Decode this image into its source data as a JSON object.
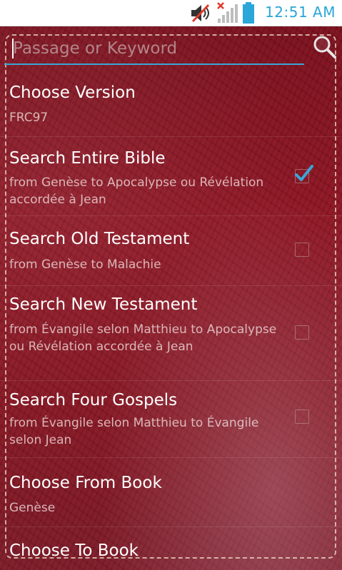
{
  "status_bar": {
    "time": "12:51 AM",
    "icons": [
      "speaker-muted-icon",
      "signal-off-icon",
      "battery-icon"
    ]
  },
  "search": {
    "placeholder": "Passage or Keyword",
    "value": "",
    "icon": "search-icon"
  },
  "options": [
    {
      "title": "Choose Version",
      "subtitle": "FRC97"
    },
    {
      "title": "Search Entire Bible",
      "subtitle": "from Genèse to Apocalypse ou Révélation accordée à Jean",
      "checked": true
    },
    {
      "title": "Search Old Testament",
      "subtitle": "from Genèse to Malachie",
      "checked": false
    },
    {
      "title": "Search New Testament",
      "subtitle": "from Évangile selon Matthieu to Apocalypse ou Révélation accordée à Jean",
      "checked": false
    },
    {
      "title": "Search Four Gospels",
      "subtitle": "from Évangile selon Matthieu to Évangile selon Jean",
      "checked": false
    },
    {
      "title": "Choose From Book",
      "subtitle": "Genèse"
    },
    {
      "title": "Choose To Book"
    }
  ],
  "colors": {
    "accent": "#3aa6d6",
    "clock": "#2aa6d8",
    "leather": "#8e1423"
  }
}
